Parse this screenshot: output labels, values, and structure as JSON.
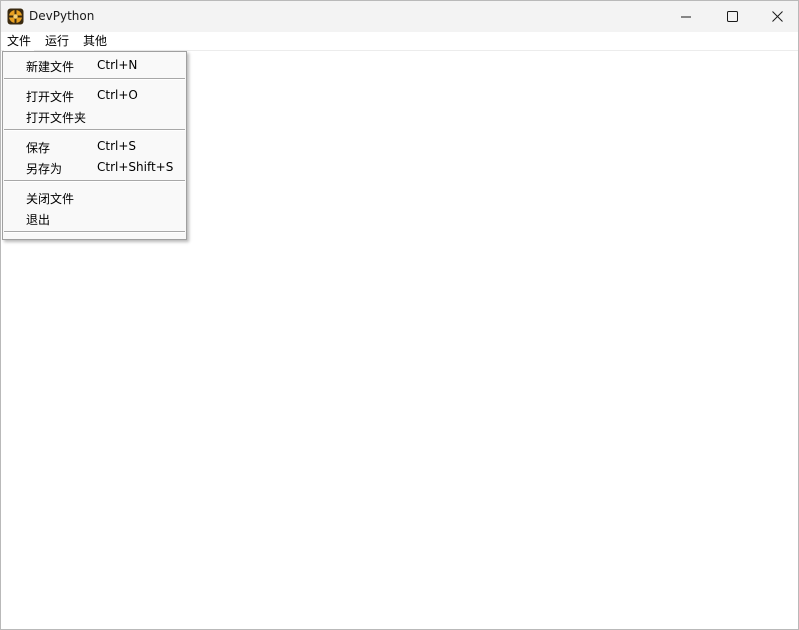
{
  "window": {
    "title": "DevPython"
  },
  "menubar": {
    "items": [
      {
        "label": "文件"
      },
      {
        "label": "运行"
      },
      {
        "label": "其他"
      }
    ]
  },
  "file_menu": {
    "items": [
      {
        "label": "新建文件",
        "shortcut": "Ctrl+N"
      },
      {
        "label": "打开文件",
        "shortcut": "Ctrl+O"
      },
      {
        "label": "打开文件夹",
        "shortcut": ""
      },
      {
        "label": "保存",
        "shortcut": "Ctrl+S"
      },
      {
        "label": "另存为",
        "shortcut": "Ctrl+Shift+S"
      },
      {
        "label": "关闭文件",
        "shortcut": ""
      },
      {
        "label": "退出",
        "shortcut": ""
      }
    ]
  },
  "icons": {
    "app": "python-app-icon",
    "minimize": "minimize-icon",
    "maximize": "maximize-icon",
    "close": "close-icon"
  },
  "colors": {
    "titlebar_bg": "#f3f3f3",
    "menu_bg": "#f9f9f9",
    "separator": "#a8a8a8",
    "app_icon_orange": "#e8a020"
  }
}
